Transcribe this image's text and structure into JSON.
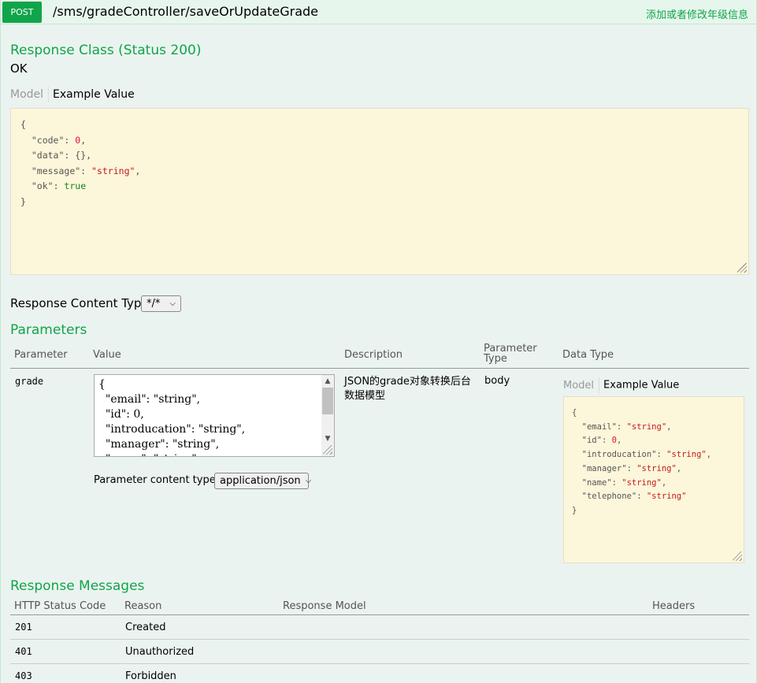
{
  "operation": {
    "method": "POST",
    "path": "/sms/gradeController/saveOrUpdateGrade",
    "summary": "添加或者修改年级信息"
  },
  "response_class": {
    "heading": "Response Class (Status 200)",
    "status_text": "OK",
    "tab_model": "Model",
    "tab_example": "Example Value",
    "example_lines": [
      {
        "text": "{"
      },
      {
        "key": "\"code\"",
        "val": "0",
        "kind": "n",
        "tail": ","
      },
      {
        "key": "\"data\"",
        "val": "{}",
        "kind": "k",
        "tail": ","
      },
      {
        "key": "\"message\"",
        "val": "\"string\"",
        "kind": "s",
        "tail": ","
      },
      {
        "key": "\"ok\"",
        "val": "true",
        "kind": "b",
        "tail": ""
      },
      {
        "text": "}"
      }
    ]
  },
  "response_content_type": {
    "label": "Response Content Type",
    "value": "*/*"
  },
  "parameters": {
    "heading": "Parameters",
    "columns": {
      "parameter": "Parameter",
      "value": "Value",
      "description": "Description",
      "parameter_type_1": "Parameter",
      "parameter_type_2": "Type",
      "data_type": "Data Type"
    },
    "row": {
      "name": "grade",
      "value_lines": [
        "{",
        "  \"email\": \"string\",",
        "  \"id\": 0,",
        "  \"introducation\": \"string\",",
        "  \"manager\": \"string\",",
        "  \"name\": \"string\","
      ],
      "description": "JSON的grade对象转换后台数据模型",
      "param_type": "body",
      "content_type_label": "Parameter content type:",
      "content_type_value": "application/json",
      "tab_model": "Model",
      "tab_example": "Example Value",
      "example_lines": [
        {
          "text": "{"
        },
        {
          "key": "\"email\"",
          "val": "\"string\"",
          "kind": "s",
          "tail": ","
        },
        {
          "key": "\"id\"",
          "val": "0",
          "kind": "n",
          "tail": ","
        },
        {
          "key": "\"introducation\"",
          "val": "\"string\"",
          "kind": "s",
          "tail": ","
        },
        {
          "key": "\"manager\"",
          "val": "\"string\"",
          "kind": "s",
          "tail": ","
        },
        {
          "key": "\"name\"",
          "val": "\"string\"",
          "kind": "s",
          "tail": ","
        },
        {
          "key": "\"telephone\"",
          "val": "\"string\"",
          "kind": "s",
          "tail": ""
        },
        {
          "text": "}"
        }
      ]
    }
  },
  "response_messages": {
    "heading": "Response Messages",
    "columns": {
      "code": "HTTP Status Code",
      "reason": "Reason",
      "model": "Response Model",
      "headers": "Headers"
    },
    "rows": [
      {
        "code": "201",
        "reason": "Created"
      },
      {
        "code": "401",
        "reason": "Unauthorized"
      },
      {
        "code": "403",
        "reason": "Forbidden"
      }
    ]
  },
  "colors": {
    "accent": "#10a54a",
    "panel_bg": "#ebf3f0",
    "code_bg": "#fcf6db"
  }
}
